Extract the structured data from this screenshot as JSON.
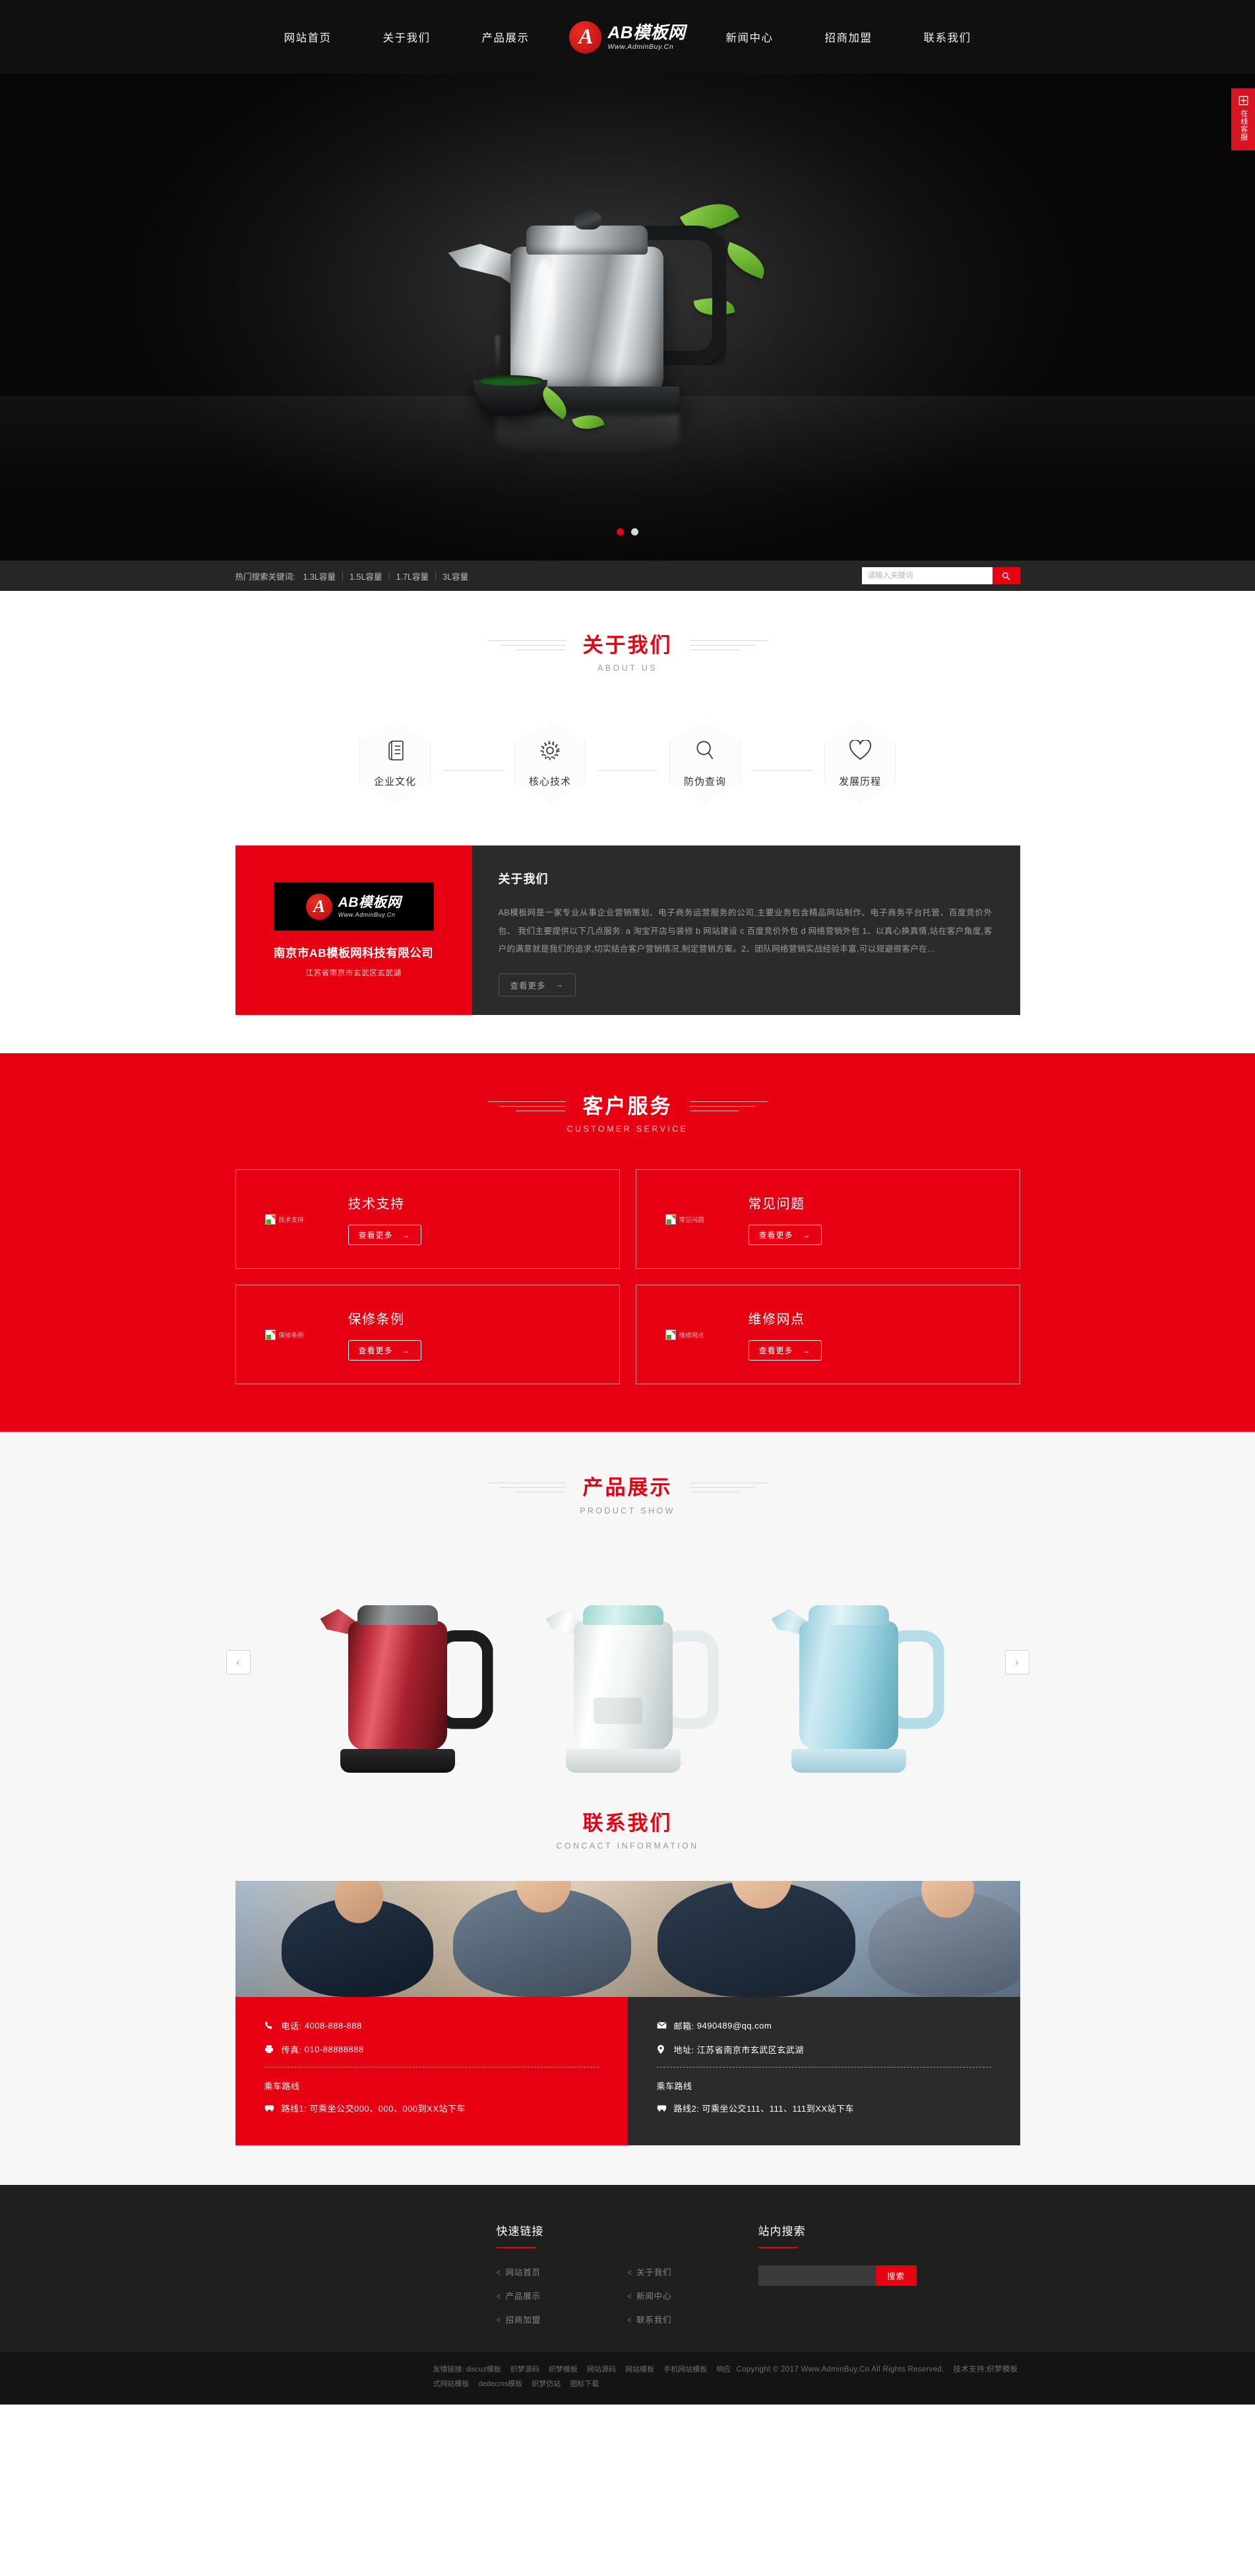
{
  "header": {
    "nav_left": [
      {
        "label": "网站首页"
      },
      {
        "label": "关于我们"
      },
      {
        "label": "产品展示"
      }
    ],
    "nav_right": [
      {
        "label": "新闻中心"
      },
      {
        "label": "招商加盟"
      },
      {
        "label": "联系我们"
      }
    ],
    "logo": {
      "mark": "A",
      "main": "AB模板网",
      "sub": "Www.AdminBuy.Cn"
    }
  },
  "banner": {
    "dots": [
      "active",
      "inactive"
    ]
  },
  "searchbar": {
    "hot_label": "热门搜索关键词:",
    "hot_words": [
      "1.3L容量",
      "1.5L容量",
      "1.7L容量",
      "3L容量"
    ],
    "placeholder": "请输入关键词",
    "button_icon": "search-icon"
  },
  "about": {
    "title": "关于我们",
    "title_en": "ABOUT US",
    "features": [
      {
        "label": "企业文化",
        "icon": "book-icon"
      },
      {
        "label": "核心技术",
        "icon": "gear-icon"
      },
      {
        "label": "防伪查询",
        "icon": "search-icon"
      },
      {
        "label": "发展历程",
        "icon": "heart-icon"
      }
    ],
    "card": {
      "logo_mark": "A",
      "logo_main": "AB模板网",
      "logo_sub": "Www.AdminBuy.Cn",
      "company": "南京市AB模板网科技有限公司",
      "address": "江苏省南京市玄武区玄武湖"
    },
    "panel_title": "关于我们",
    "panel_text": "AB模板网是一家专业从事企业营销策划、电子商务运营服务的公司,主要业务包含精品网站制作、电子商务平台托管、百度竞价外包、 我们主要提供以下几点服务: a 淘宝开店与装修 b 网站建设 c 百度竞价外包 d 网络营销外包 1、以真心换真情,站在客户角度,客户的满意就是我们的追求,切实结合客户营销情况,制定营销方案。2、团队网络营销实战经验丰富,可以规避很客户在...",
    "more_label": "查看更多",
    "more_arrow": "→"
  },
  "service": {
    "title": "客户服务",
    "title_en": "CUSTOMER SERVICE",
    "cards": [
      {
        "title": "技术支持",
        "alt": "技术支持",
        "more_label": "查看更多",
        "more_arrow": "→"
      },
      {
        "title": "常见问题",
        "alt": "常见问题",
        "more_label": "查看更多",
        "more_arrow": "→"
      },
      {
        "title": "保修条例",
        "alt": "保修条例",
        "more_label": "查看更多",
        "more_arrow": "→"
      },
      {
        "title": "维修网点",
        "alt": "维修网点",
        "more_label": "查看更多",
        "more_arrow": "→"
      }
    ]
  },
  "products": {
    "title": "产品展示",
    "title_en": "PRODUCT SHOW",
    "prev_icon": "chevron-left-icon",
    "next_icon": "chevron-right-icon",
    "items": [
      {
        "variant": "red"
      },
      {
        "variant": "white"
      },
      {
        "variant": "blue"
      }
    ]
  },
  "contact": {
    "title": "联系我们",
    "title_en": "CONCACT INFORMATION",
    "left": {
      "phone_label": "电话:",
      "phone": "4008-888-888",
      "fax_label": "传真:",
      "fax": "010-88888888",
      "route_title": "乘车路线",
      "route_label": "路线1:",
      "route": "可乘坐公交000、000、000到XX站下车"
    },
    "right": {
      "email_label": "邮箱:",
      "email": "9490489@qq.com",
      "address_label": "地址:",
      "address": "江苏省南京市玄武区玄武湖",
      "route_title": "乘车路线",
      "route_label": "路线2:",
      "route": "可乘坐公交111、111、111到XX站下车"
    }
  },
  "footer": {
    "quick_title": "快速链接",
    "quick_links": [
      {
        "label": "网站首页"
      },
      {
        "label": "关于我们"
      },
      {
        "label": "产品展示"
      },
      {
        "label": "新闻中心"
      },
      {
        "label": "招商加盟"
      },
      {
        "label": "联系我们"
      }
    ],
    "search_title": "站内搜索",
    "search_value": "",
    "search_button": "搜索",
    "friend_label": "友情链接:",
    "friend_links": [
      "discuz模板",
      "织梦源码",
      "织梦模板",
      "网站源码",
      "网站模板",
      "手机网站模板",
      "响应式网站模板",
      "dedecms模板",
      "织梦仿站",
      "图标下载"
    ],
    "copyright": "Copyright © 2017 Www.AdminBuy.Cn All Rights Reserved.",
    "tech_support": "技术支持:织梦模板"
  },
  "side_widget": {
    "icon": "service-icon",
    "label": "在线客服"
  },
  "colors": {
    "brand_red": "#e60012",
    "dark": "#2b2b2b",
    "header_black": "#111011"
  }
}
